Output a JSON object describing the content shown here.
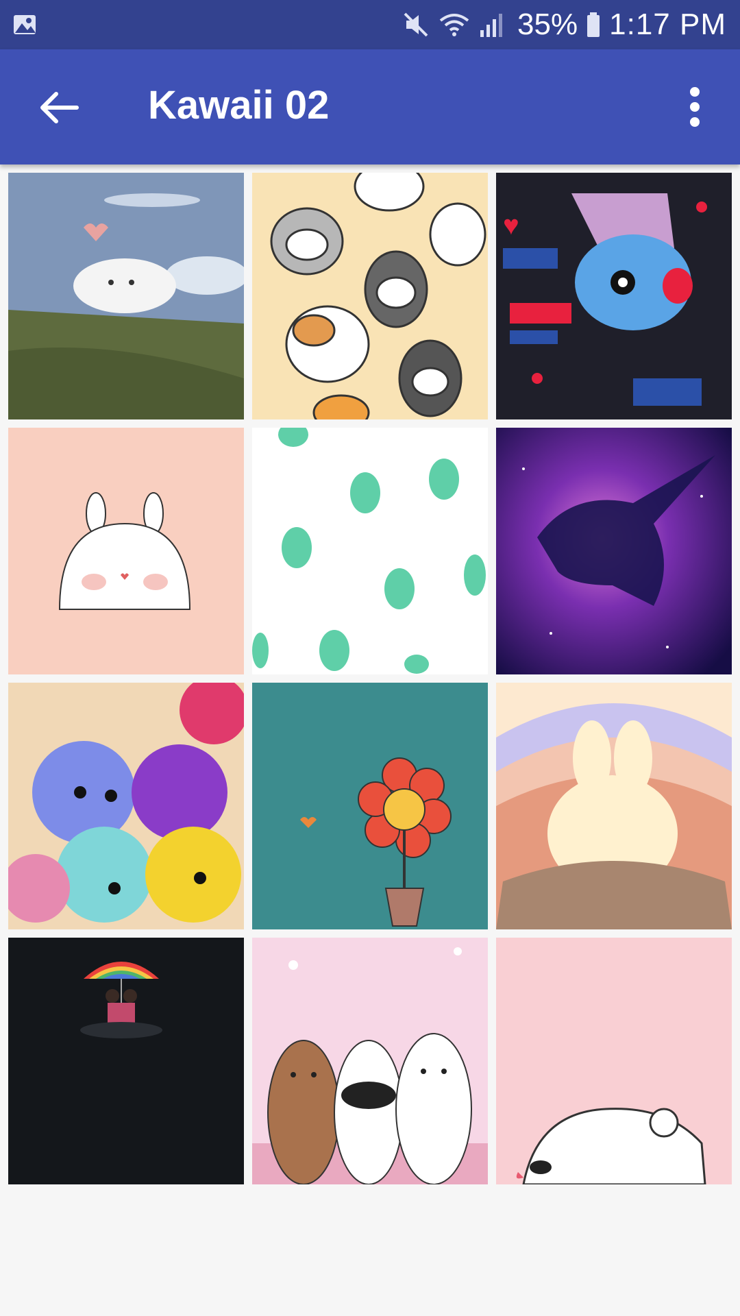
{
  "status_bar": {
    "battery": "35%",
    "time": "1:17 PM",
    "icons": [
      "gallery-icon",
      "mute-icon",
      "wifi-icon",
      "signal-icon",
      "battery-icon"
    ]
  },
  "app_bar": {
    "title": "Kawaii 02",
    "back_icon": "arrow-back-icon",
    "menu_icon": "more-vert-icon"
  },
  "wallpapers": [
    {
      "subject": "cloud-bear-on-hill"
    },
    {
      "subject": "cat-pattern"
    },
    {
      "subject": "mang-pattern"
    },
    {
      "subject": "bunny-peach"
    },
    {
      "subject": "dino-pattern"
    },
    {
      "subject": "galaxy-unicorn"
    },
    {
      "subject": "fluffy-creatures"
    },
    {
      "subject": "flower-pot"
    },
    {
      "subject": "bunny-rainbow"
    },
    {
      "subject": "rainbow-umbrella"
    },
    {
      "subject": "bare-bears"
    },
    {
      "subject": "polar-bear-pink"
    }
  ]
}
